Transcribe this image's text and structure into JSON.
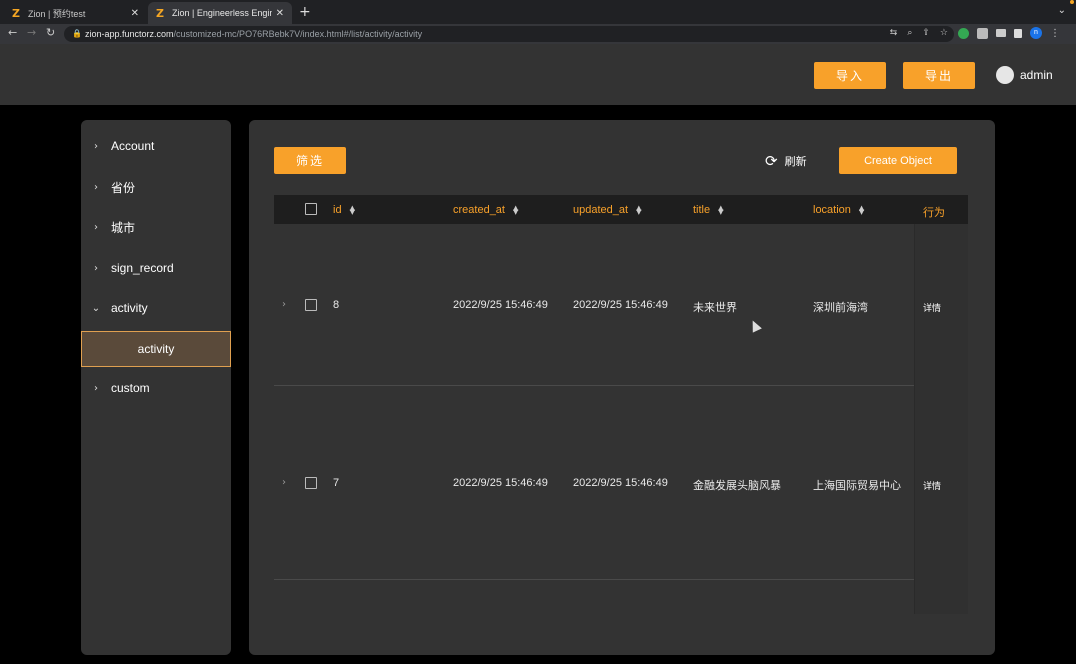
{
  "browser": {
    "tabs": [
      {
        "title": "Zion | 预约test",
        "active": false
      },
      {
        "title": "Zion | Engineerless Engineering",
        "active": true
      }
    ],
    "url_host": "zion-app.functorz.com",
    "url_path": "/customized-mc/PO76RBebk7V/index.html#/list/activity/activity"
  },
  "header": {
    "import_label": "导入",
    "export_label": "导出",
    "username": "admin"
  },
  "sidebar": {
    "items": [
      {
        "label": "Account",
        "expanded": false
      },
      {
        "label": "省份",
        "expanded": false
      },
      {
        "label": "城市",
        "expanded": false
      },
      {
        "label": "sign_record",
        "expanded": false
      },
      {
        "label": "activity",
        "expanded": true
      },
      {
        "label": "custom",
        "expanded": false
      }
    ],
    "active_sub": "activity"
  },
  "toolbar": {
    "filter_label": "筛选",
    "refresh_label": "刷新",
    "create_label": "Create Object"
  },
  "table": {
    "columns": [
      "id",
      "created_at",
      "updated_at",
      "title",
      "location",
      "行为"
    ],
    "rows": [
      {
        "id": "8",
        "created_at": "2022/9/25 15:46:49",
        "updated_at": "2022/9/25 15:46:49",
        "title": "未来世界",
        "location": "深圳前海湾",
        "action": "详情"
      },
      {
        "id": "7",
        "created_at": "2022/9/25 15:46:49",
        "updated_at": "2022/9/25 15:46:49",
        "title": "金融发展头脑风暴",
        "location": "上海国际贸易中心",
        "action": "详情"
      }
    ]
  },
  "colors": {
    "accent": "#f8a12a",
    "panel": "#333333",
    "background": "#000000"
  }
}
